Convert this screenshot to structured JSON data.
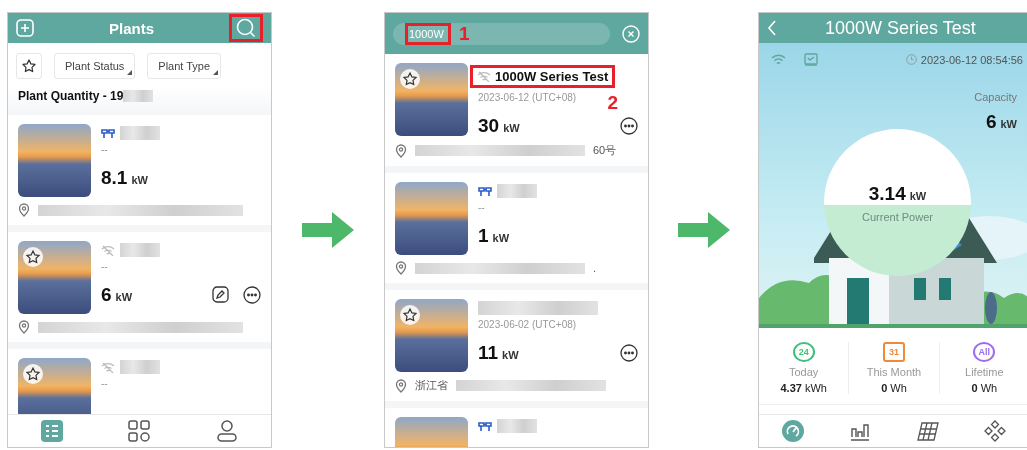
{
  "plants_screen": {
    "title": "Plants",
    "filters": [
      {
        "label": "Plant Status"
      },
      {
        "label": "Plant Type"
      }
    ],
    "quantity_label": "Plant Quantity - 19",
    "plants": [
      {
        "favorite_icon": false,
        "online": true,
        "date": "--",
        "power": "8.1",
        "unit": "kW",
        "edit": false,
        "more": false
      },
      {
        "favorite_icon": true,
        "online": false,
        "date": "--",
        "power": "6",
        "unit": "kW",
        "edit": true,
        "more": true
      },
      {
        "favorite_icon": true,
        "online": false,
        "date": "--"
      }
    ],
    "nav": [
      {
        "selected": true
      },
      {
        "selected": false
      },
      {
        "selected": false
      }
    ]
  },
  "search_screen": {
    "query": "1000W",
    "annotation": "1",
    "plants": [
      {
        "favorite_icon": true,
        "online": false,
        "name": "1000W Series Test",
        "annotation": "2",
        "date": "2023-06-12 (UTC+08)",
        "power": "30",
        "unit": "kW",
        "more": true,
        "address_suffix": "60号"
      },
      {
        "favorite_icon": false,
        "online": true,
        "date": "--",
        "power": "1",
        "unit": "kW",
        "more": false,
        "address_suffix": "."
      },
      {
        "favorite_icon": true,
        "date": "2023-06-02 (UTC+08)",
        "power": "11",
        "unit": "kW",
        "more": true,
        "address_prefix": "浙江省"
      },
      {
        "favorite_icon": false,
        "online": true
      }
    ]
  },
  "detail_screen": {
    "title": "1000W Series Test",
    "timestamp": "2023-06-12 08:54:56",
    "capacity_label": "Capacity",
    "capacity": "6",
    "capacity_unit": "kW",
    "current_power": "3.14",
    "current_unit": "kW",
    "current_label": "Current Power",
    "stats": [
      {
        "badge": "24",
        "label": "Today",
        "value": "4.37",
        "unit": "kWh",
        "color": "#3cc07a"
      },
      {
        "badge": "31",
        "label": "This Month",
        "value": "0",
        "unit": "Wh",
        "color": "#f08a3a"
      },
      {
        "badge": "All",
        "label": "Lifetime",
        "value": "0",
        "unit": "Wh",
        "color": "#9a6cf0"
      }
    ],
    "tabs": [
      {
        "selected": true
      },
      {
        "selected": false
      },
      {
        "selected": false
      },
      {
        "selected": false
      }
    ]
  }
}
